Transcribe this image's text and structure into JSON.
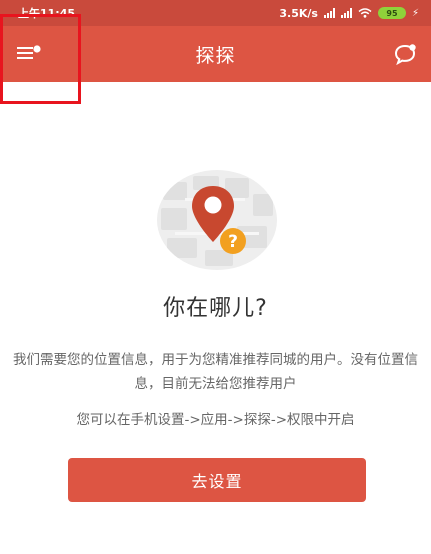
{
  "status_bar": {
    "time": "上午11:45",
    "network_speed": "3.5K/s",
    "battery_level": "95",
    "icons": [
      "signal-icon",
      "signal-icon",
      "wifi-icon",
      "battery-icon",
      "charging-icon"
    ]
  },
  "app_bar": {
    "title": "探探",
    "left_icon": "menu-icon",
    "right_icon": "chat-bubble-icon"
  },
  "empty_state": {
    "illustration": "location-pin-question-icon",
    "heading": "你在哪儿?",
    "description": "我们需要您的位置信息，用于为您精准推荐同城的用户。没有位置信息，目前无法给您推荐用户",
    "hint": "您可以在手机设置->应用->探探->权限中开启",
    "button_label": "去设置"
  },
  "colors": {
    "status_bar": "#c94a3c",
    "app_bar": "#dd5543",
    "accent": "#dd5543",
    "pin": "#c8482f",
    "badge": "#f2a020",
    "highlight_annotation": "#e8141e"
  }
}
